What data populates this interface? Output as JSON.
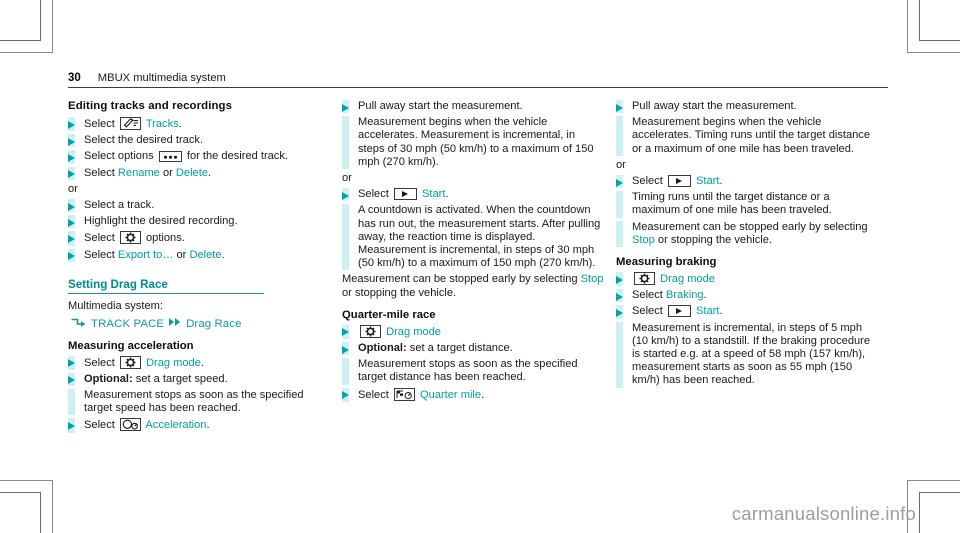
{
  "page": {
    "number": "30",
    "chapter": "MBUX multimedia system",
    "watermark": "carmanualsonline.info"
  },
  "columns": [
    {
      "id": "column-1",
      "blocks": [
        {
          "type": "heading",
          "text": "Editing tracks and recordings"
        },
        {
          "type": "step",
          "prefix": "Select ",
          "icon": "tracks-icon",
          "link": "Tracks",
          "suffix": "."
        },
        {
          "type": "step",
          "text": "Select the desired track."
        },
        {
          "type": "step",
          "prefix": "Select options ",
          "icon": "options-dots-icon",
          "suffix": " for the desired track."
        },
        {
          "type": "step",
          "prefix": "Select ",
          "link": "Rename",
          "mid": " or ",
          "link2": "Delete",
          "suffix": "."
        },
        {
          "type": "or",
          "text": "or"
        },
        {
          "type": "step",
          "text": "Select a track."
        },
        {
          "type": "step",
          "text": "Highlight the desired recording."
        },
        {
          "type": "step",
          "prefix": "Select ",
          "icon": "gear-icon",
          "suffix": " options."
        },
        {
          "type": "step",
          "prefix": "Select ",
          "link": "Export to…",
          "mid": " or ",
          "link2": "Delete",
          "suffix": "."
        },
        {
          "type": "heading-rule",
          "text": "Setting Drag Race"
        },
        {
          "type": "plain",
          "text": "Multimedia system:"
        },
        {
          "type": "navpath",
          "arrow1": "corner-arrow-icon",
          "item1": "TRACK PACE",
          "arrow2": "double-arrow-icon",
          "item2": "Drag Race"
        },
        {
          "type": "subheading",
          "text": "Measuring acceleration"
        },
        {
          "type": "step",
          "prefix": "Select ",
          "icon": "gear-icon",
          "link": "Drag mode",
          "suffix": "."
        },
        {
          "type": "step",
          "bold": "Optional:",
          "text": " set a target speed."
        },
        {
          "type": "cont",
          "text": "Measurement stops as soon as the specified target speed has been reached."
        },
        {
          "type": "step",
          "prefix": "Select ",
          "icon": "acceleration-icon",
          "link": "Acceleration",
          "suffix": "."
        }
      ]
    },
    {
      "id": "column-2",
      "blocks": [
        {
          "type": "step",
          "text": "Pull away start the measurement."
        },
        {
          "type": "cont",
          "text": "Measurement begins when the vehicle accelerates. Measurement is incremental, in steps of 30 mph (50 km/h) to a maximum of 150 mph (270 km/h)."
        },
        {
          "type": "or",
          "text": "or"
        },
        {
          "type": "step",
          "prefix": "Select ",
          "icon": "play-icon",
          "link": "Start",
          "suffix": "."
        },
        {
          "type": "cont",
          "text": "A countdown is activated. When the countdown has run out, the measurement starts. After pulling away, the reaction time is displayed. Measurement is incremental, in steps of 30 mph (50 km/h) to a maximum of 150 mph (270 km/h)."
        },
        {
          "type": "plain-link",
          "prefix": "Measurement can be stopped early by selecting ",
          "link": "Stop",
          "suffix": " or stopping the vehicle."
        },
        {
          "type": "subheading",
          "text": "Quarter-mile race"
        },
        {
          "type": "step",
          "icon": "gear-icon",
          "link": "Drag mode",
          "suffix": ""
        },
        {
          "type": "step",
          "bold": "Optional:",
          "text": " set a target distance."
        },
        {
          "type": "cont",
          "text": "Measurement stops as soon as the specified target distance has been reached."
        },
        {
          "type": "step",
          "prefix": "Select ",
          "icon": "quarter-mile-icon",
          "link": "Quarter mile",
          "suffix": "."
        }
      ]
    },
    {
      "id": "column-3",
      "blocks": [
        {
          "type": "step",
          "text": "Pull away start the measurement."
        },
        {
          "type": "cont",
          "text": "Measurement begins when the vehicle accelerates. Timing runs until the target distance or a maximum of one mile has been traveled."
        },
        {
          "type": "or",
          "text": "or"
        },
        {
          "type": "step",
          "prefix": "Select ",
          "icon": "play-icon",
          "link": "Start",
          "suffix": "."
        },
        {
          "type": "cont",
          "text": "Timing runs until the target distance or a maximum of one mile has been traveled."
        },
        {
          "type": "cont2",
          "prefix": "Measurement can be stopped early by selecting ",
          "link": "Stop",
          "suffix": " or stopping the vehicle."
        },
        {
          "type": "subheading",
          "text": "Measuring braking"
        },
        {
          "type": "step",
          "icon": "gear-icon",
          "link": "Drag mode",
          "suffix": ""
        },
        {
          "type": "step",
          "prefix": "Select ",
          "link": "Braking",
          "suffix": "."
        },
        {
          "type": "step",
          "prefix": "Select ",
          "icon": "play-icon",
          "link": "Start",
          "suffix": "."
        },
        {
          "type": "cont",
          "text": "Measurement is incremental, in steps of 5 mph (10 km/h) to a standstill. If the braking procedure is started e.g. at a speed of 58 mph (157 km/h), measurement starts as soon as 55 mph (150 km/h) has been reached."
        }
      ]
    }
  ],
  "colors": {
    "teal": "#00a0a0",
    "teal_bar": "#cdf0f0",
    "teal_arrow": "#00a6a6",
    "heading_rule": "#0c9a9a"
  }
}
